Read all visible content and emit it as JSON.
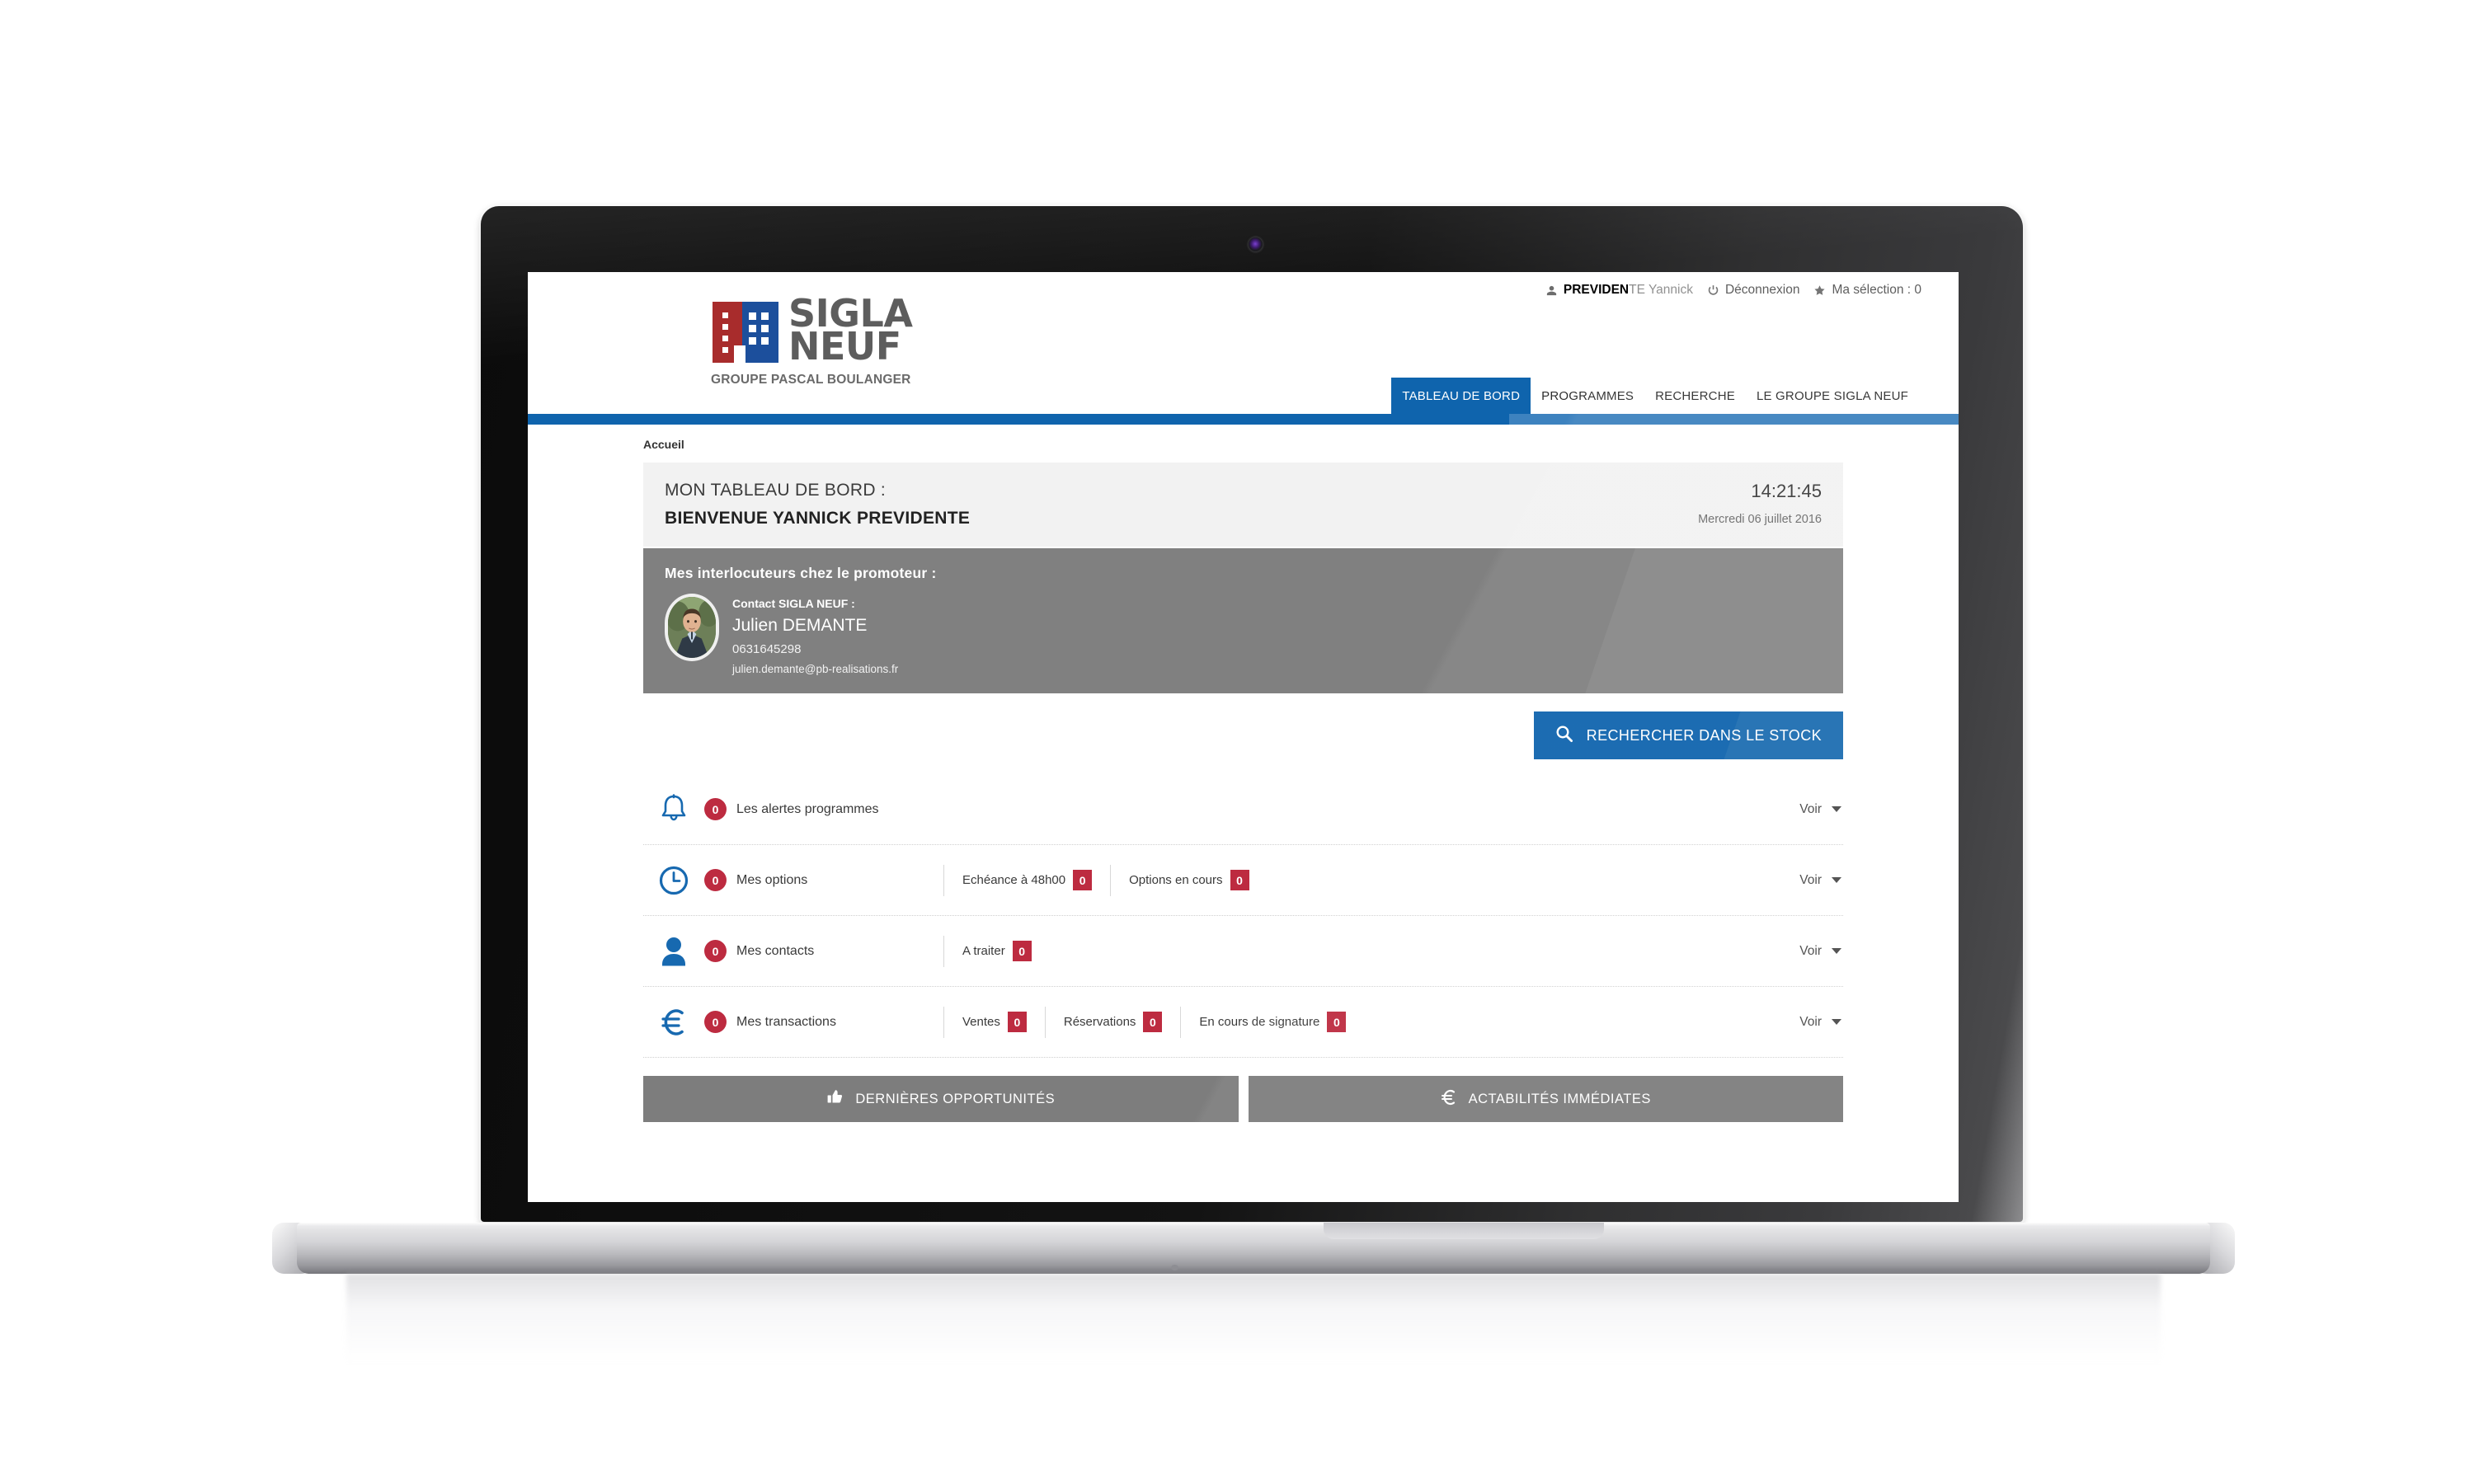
{
  "topbar": {
    "user_icon": "user-icon",
    "user_name_bold": "PREVIDEN",
    "user_name_rest": "TE Yannick",
    "logout_icon": "power-icon",
    "logout_label": "Déconnexion",
    "star_icon": "star-icon",
    "selection_label": "Ma sélection : 0"
  },
  "logo": {
    "line1": "SIGLA",
    "line2": "NEUF",
    "tagline": "GROUPE PASCAL BOULANGER",
    "mark_icon": "building-logo-icon",
    "colors": {
      "red": "#a82c2c",
      "blue": "#1c4f9c",
      "text_gray": "#5d5d5d"
    }
  },
  "nav": {
    "items": [
      {
        "label": "TABLEAU DE BORD",
        "active": true
      },
      {
        "label": "PROGRAMMES",
        "active": false
      },
      {
        "label": "RECHERCHE",
        "active": false
      },
      {
        "label": "LE GROUPE SIGLA NEUF",
        "active": false
      }
    ],
    "accent_color": "#0f64ad"
  },
  "breadcrumb": "Accueil",
  "dashboard_header": {
    "title": "MON TABLEAU DE BORD :",
    "welcome": "BIENVENUE YANNICK PREVIDENTE",
    "time": "14:21:45",
    "date": "Mercredi 06 juillet 2016"
  },
  "contact_panel": {
    "title": "Mes interlocuteurs chez le promoteur :",
    "avatar_icon": "avatar-photo",
    "label": "Contact SIGLA NEUF :",
    "name": "Julien DEMANTE",
    "phone": "0631645298",
    "email": "julien.demante@pb-realisations.fr"
  },
  "search_stock": {
    "icon": "search-icon",
    "label": "RECHERCHER DANS LE STOCK"
  },
  "stat_rows": [
    {
      "icon": "bell-icon",
      "count": "0",
      "label": "Les alertes programmes",
      "subs": [],
      "voir": "Voir"
    },
    {
      "icon": "clock-icon",
      "count": "0",
      "label": "Mes options",
      "subs": [
        {
          "label": "Echéance à 48h00",
          "count": "0"
        },
        {
          "label": "Options en cours",
          "count": "0"
        }
      ],
      "voir": "Voir"
    },
    {
      "icon": "person-icon",
      "count": "0",
      "label": "Mes contacts",
      "subs": [
        {
          "label": "A traiter",
          "count": "0"
        }
      ],
      "voir": "Voir"
    },
    {
      "icon": "euro-icon",
      "count": "0",
      "label": "Mes transactions",
      "subs": [
        {
          "label": "Ventes",
          "count": "0"
        },
        {
          "label": "Réservations",
          "count": "0"
        },
        {
          "label": "En cours de signature",
          "count": "0"
        }
      ],
      "voir": "Voir"
    }
  ],
  "bottom_tabs": [
    {
      "icon": "thumbs-up-icon",
      "label": "DERNIÈRES OPPORTUNITÉS"
    },
    {
      "icon": "euro-icon",
      "label": "ACTABILITÉS IMMÉDIATES"
    }
  ],
  "colors": {
    "brand_blue": "#0f64ad",
    "badge_red": "#bd2b40",
    "panel_gray": "#808080",
    "header_gray": "#f2f2f2",
    "icon_blue": "#1769b0"
  }
}
